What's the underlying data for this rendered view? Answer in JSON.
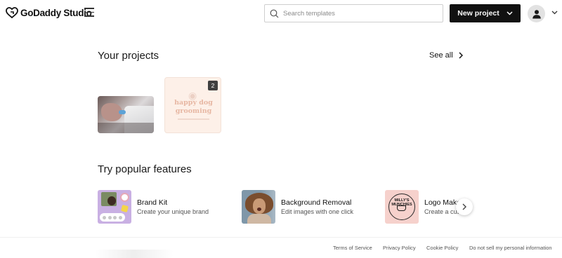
{
  "header": {
    "brand": "GoDaddy Studio",
    "search_placeholder": "Search templates",
    "new_project_label": "New project"
  },
  "projects": {
    "title": "Your projects",
    "see_all_label": "See all",
    "items": [
      {
        "name": "photo-project"
      },
      {
        "name": "happy-dog-grooming",
        "text_line1": "happy dog",
        "text_line2": "grooming",
        "page_count": "2"
      }
    ]
  },
  "features": {
    "title": "Try popular features",
    "items": [
      {
        "title": "Brand Kit",
        "subtitle": "Create your unique brand"
      },
      {
        "title": "Background Removal",
        "subtitle": "Edit images with one click"
      },
      {
        "title": "Logo Maker",
        "subtitle": "Create a custom logo",
        "logo_text": "MILLY'S MUNCHIES"
      }
    ]
  },
  "footer": {
    "links": [
      "Terms of Service",
      "Privacy Policy",
      "Cookie Policy",
      "Do not sell my personal information"
    ]
  },
  "colors": {
    "primary_button": "#111111",
    "accent_lavender": "#c9b0e3",
    "accent_peach": "#fdf0e8"
  }
}
